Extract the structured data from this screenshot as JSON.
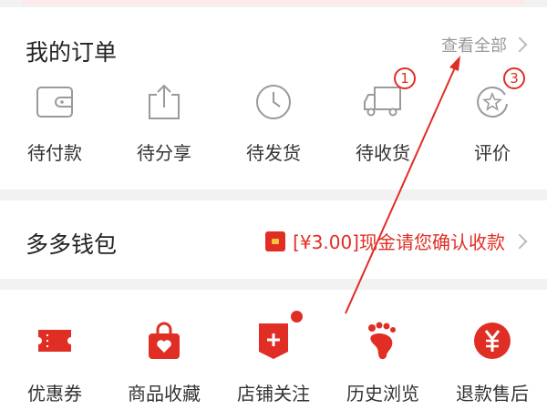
{
  "orders": {
    "title": "我的订单",
    "see_all": "查看全部",
    "items": [
      {
        "label": "待付款",
        "icon": "wallet-icon"
      },
      {
        "label": "待分享",
        "icon": "share-icon"
      },
      {
        "label": "待发货",
        "icon": "clock-icon"
      },
      {
        "label": "待收货",
        "icon": "truck-icon",
        "badge": "1"
      },
      {
        "label": "评价",
        "icon": "review-icon",
        "badge": "3"
      }
    ]
  },
  "wallet": {
    "title": "多多钱包",
    "promo": "[¥3.00]现金请您确认收款",
    "promo_icon": "red-envelope-icon"
  },
  "tools": {
    "items": [
      {
        "label": "优惠券",
        "icon": "coupon-icon"
      },
      {
        "label": "商品收藏",
        "icon": "favorite-bag-icon"
      },
      {
        "label": "店铺关注",
        "icon": "store-follow-icon",
        "dot": true
      },
      {
        "label": "历史浏览",
        "icon": "footprint-icon"
      },
      {
        "label": "退款售后",
        "icon": "refund-icon"
      }
    ]
  },
  "colors": {
    "accent": "#e02e24",
    "muted_text": "#999999",
    "icon_gray": "#9a9a9a",
    "background": "#f2f2f2"
  }
}
